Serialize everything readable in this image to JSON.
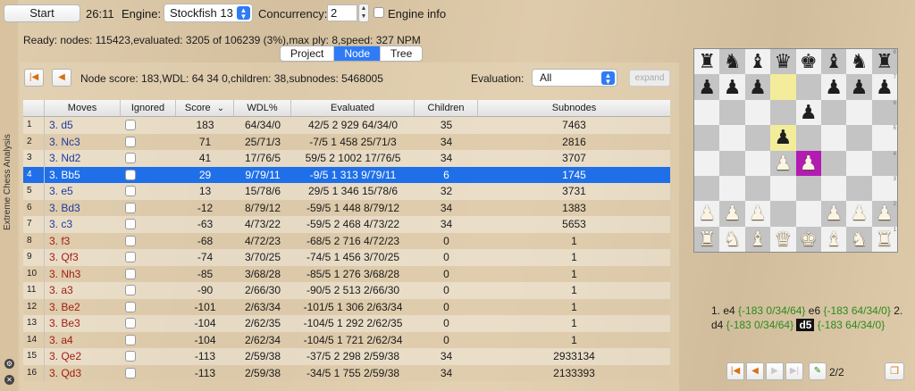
{
  "app": {
    "side_label": "Extreme Chess Analysis"
  },
  "toolbar": {
    "start_label": "Start",
    "time": "26:11",
    "engine_label": "Engine:",
    "engine_value": "Stockfish 13",
    "concurrency_label": "Concurrency:",
    "concurrency_value": "2",
    "engine_info_label": "Engine info"
  },
  "status": "Ready: nodes: 115423,evaluated: 3205 of 106239 (3%),max ply: 8,speed: 327 NPM",
  "tabs": [
    {
      "label": "Project",
      "active": false
    },
    {
      "label": "Node",
      "active": true
    },
    {
      "label": "Tree",
      "active": false
    }
  ],
  "node_info": "Node score: 183,WDL: 64 34 0,children: 38,subnodes: 5468005",
  "evaluation": {
    "label": "Evaluation:",
    "value": "All",
    "expand_label": "expand"
  },
  "table": {
    "headers": [
      "Moves",
      "Ignored",
      "Score",
      "WDL%",
      "Evaluated",
      "Children",
      "Subnodes"
    ],
    "sort_indicator": "⌄",
    "rows": [
      {
        "idx": "1",
        "move": "3. d5",
        "color": "blue",
        "score": "183",
        "wdl": "64/34/0",
        "evaluated": "42/5 2 929 64/34/0",
        "children": "35",
        "subnodes": "7463",
        "selected": false
      },
      {
        "idx": "2",
        "move": "3. Nc3",
        "color": "blue",
        "score": "71",
        "wdl": "25/71/3",
        "evaluated": "-7/5 1 458 25/71/3",
        "children": "34",
        "subnodes": "2816",
        "selected": false
      },
      {
        "idx": "3",
        "move": "3. Nd2",
        "color": "blue",
        "score": "41",
        "wdl": "17/76/5",
        "evaluated": "59/5 2 1002 17/76/5",
        "children": "34",
        "subnodes": "3707",
        "selected": false
      },
      {
        "idx": "4",
        "move": "3. Bb5",
        "color": "blue",
        "score": "29",
        "wdl": "9/79/11",
        "evaluated": "-9/5 1 313 9/79/11",
        "children": "6",
        "subnodes": "1745",
        "selected": true
      },
      {
        "idx": "5",
        "move": "3. e5",
        "color": "blue",
        "score": "13",
        "wdl": "15/78/6",
        "evaluated": "29/5 1 346 15/78/6",
        "children": "32",
        "subnodes": "3731",
        "selected": false
      },
      {
        "idx": "6",
        "move": "3. Bd3",
        "color": "blue",
        "score": "-12",
        "wdl": "8/79/12",
        "evaluated": "-59/5 1 448 8/79/12",
        "children": "34",
        "subnodes": "1383",
        "selected": false
      },
      {
        "idx": "7",
        "move": "3. c3",
        "color": "blue",
        "score": "-63",
        "wdl": "4/73/22",
        "evaluated": "-59/5 2 468 4/73/22",
        "children": "34",
        "subnodes": "5653",
        "selected": false
      },
      {
        "idx": "8",
        "move": "3. f3",
        "color": "red",
        "score": "-68",
        "wdl": "4/72/23",
        "evaluated": "-68/5 2 716 4/72/23",
        "children": "0",
        "subnodes": "1",
        "selected": false
      },
      {
        "idx": "9",
        "move": "3. Qf3",
        "color": "red",
        "score": "-74",
        "wdl": "3/70/25",
        "evaluated": "-74/5 1 456 3/70/25",
        "children": "0",
        "subnodes": "1",
        "selected": false
      },
      {
        "idx": "10",
        "move": "3. Nh3",
        "color": "red",
        "score": "-85",
        "wdl": "3/68/28",
        "evaluated": "-85/5 1 276 3/68/28",
        "children": "0",
        "subnodes": "1",
        "selected": false
      },
      {
        "idx": "11",
        "move": "3. a3",
        "color": "red",
        "score": "-90",
        "wdl": "2/66/30",
        "evaluated": "-90/5 2 513 2/66/30",
        "children": "0",
        "subnodes": "1",
        "selected": false
      },
      {
        "idx": "12",
        "move": "3. Be2",
        "color": "red",
        "score": "-101",
        "wdl": "2/63/34",
        "evaluated": "-101/5 1 306 2/63/34",
        "children": "0",
        "subnodes": "1",
        "selected": false
      },
      {
        "idx": "13",
        "move": "3. Be3",
        "color": "red",
        "score": "-104",
        "wdl": "2/62/35",
        "evaluated": "-104/5 1 292 2/62/35",
        "children": "0",
        "subnodes": "1",
        "selected": false
      },
      {
        "idx": "14",
        "move": "3. a4",
        "color": "red",
        "score": "-104",
        "wdl": "2/62/34",
        "evaluated": "-104/5 1 721 2/62/34",
        "children": "0",
        "subnodes": "1",
        "selected": false
      },
      {
        "idx": "15",
        "move": "3. Qe2",
        "color": "red",
        "score": "-113",
        "wdl": "2/59/38",
        "evaluated": "-37/5 2 298 2/59/38",
        "children": "34",
        "subnodes": "2933134",
        "selected": false
      },
      {
        "idx": "16",
        "move": "3. Qd3",
        "color": "red",
        "score": "-113",
        "wdl": "2/59/38",
        "evaluated": "-34/5 1 755 2/59/38",
        "children": "34",
        "subnodes": "2133393",
        "selected": false
      }
    ]
  },
  "board": {
    "ranks": [
      "rnbqkbnr",
      "ppp..ppp",
      "....p...",
      "...p....",
      "...PP...",
      "........",
      "PPP..PPP",
      "RNBQKBNR"
    ],
    "highlight_squares": [
      "d7",
      "d5"
    ],
    "last_move_square": "e4",
    "coords": [
      "8",
      "7",
      "6",
      "5",
      "4",
      "3",
      "2",
      "1"
    ]
  },
  "pgn": {
    "parts": [
      {
        "text": "1. e4 ",
        "kind": "move"
      },
      {
        "text": "{-183 0/34/64}",
        "kind": "comment"
      },
      {
        "text": " e6 ",
        "kind": "move"
      },
      {
        "text": "{-183 64/34/0}",
        "kind": "comment"
      },
      {
        "text": " 2. d4 ",
        "kind": "move"
      },
      {
        "text": "{-183 0/34/64}",
        "kind": "comment"
      },
      {
        "text": " ",
        "kind": "move"
      },
      {
        "text": "d5",
        "kind": "current"
      },
      {
        "text": " ",
        "kind": "move"
      },
      {
        "text": "{-183 64/34/0}",
        "kind": "comment"
      }
    ]
  },
  "pagination": {
    "indicator": "2/2"
  }
}
